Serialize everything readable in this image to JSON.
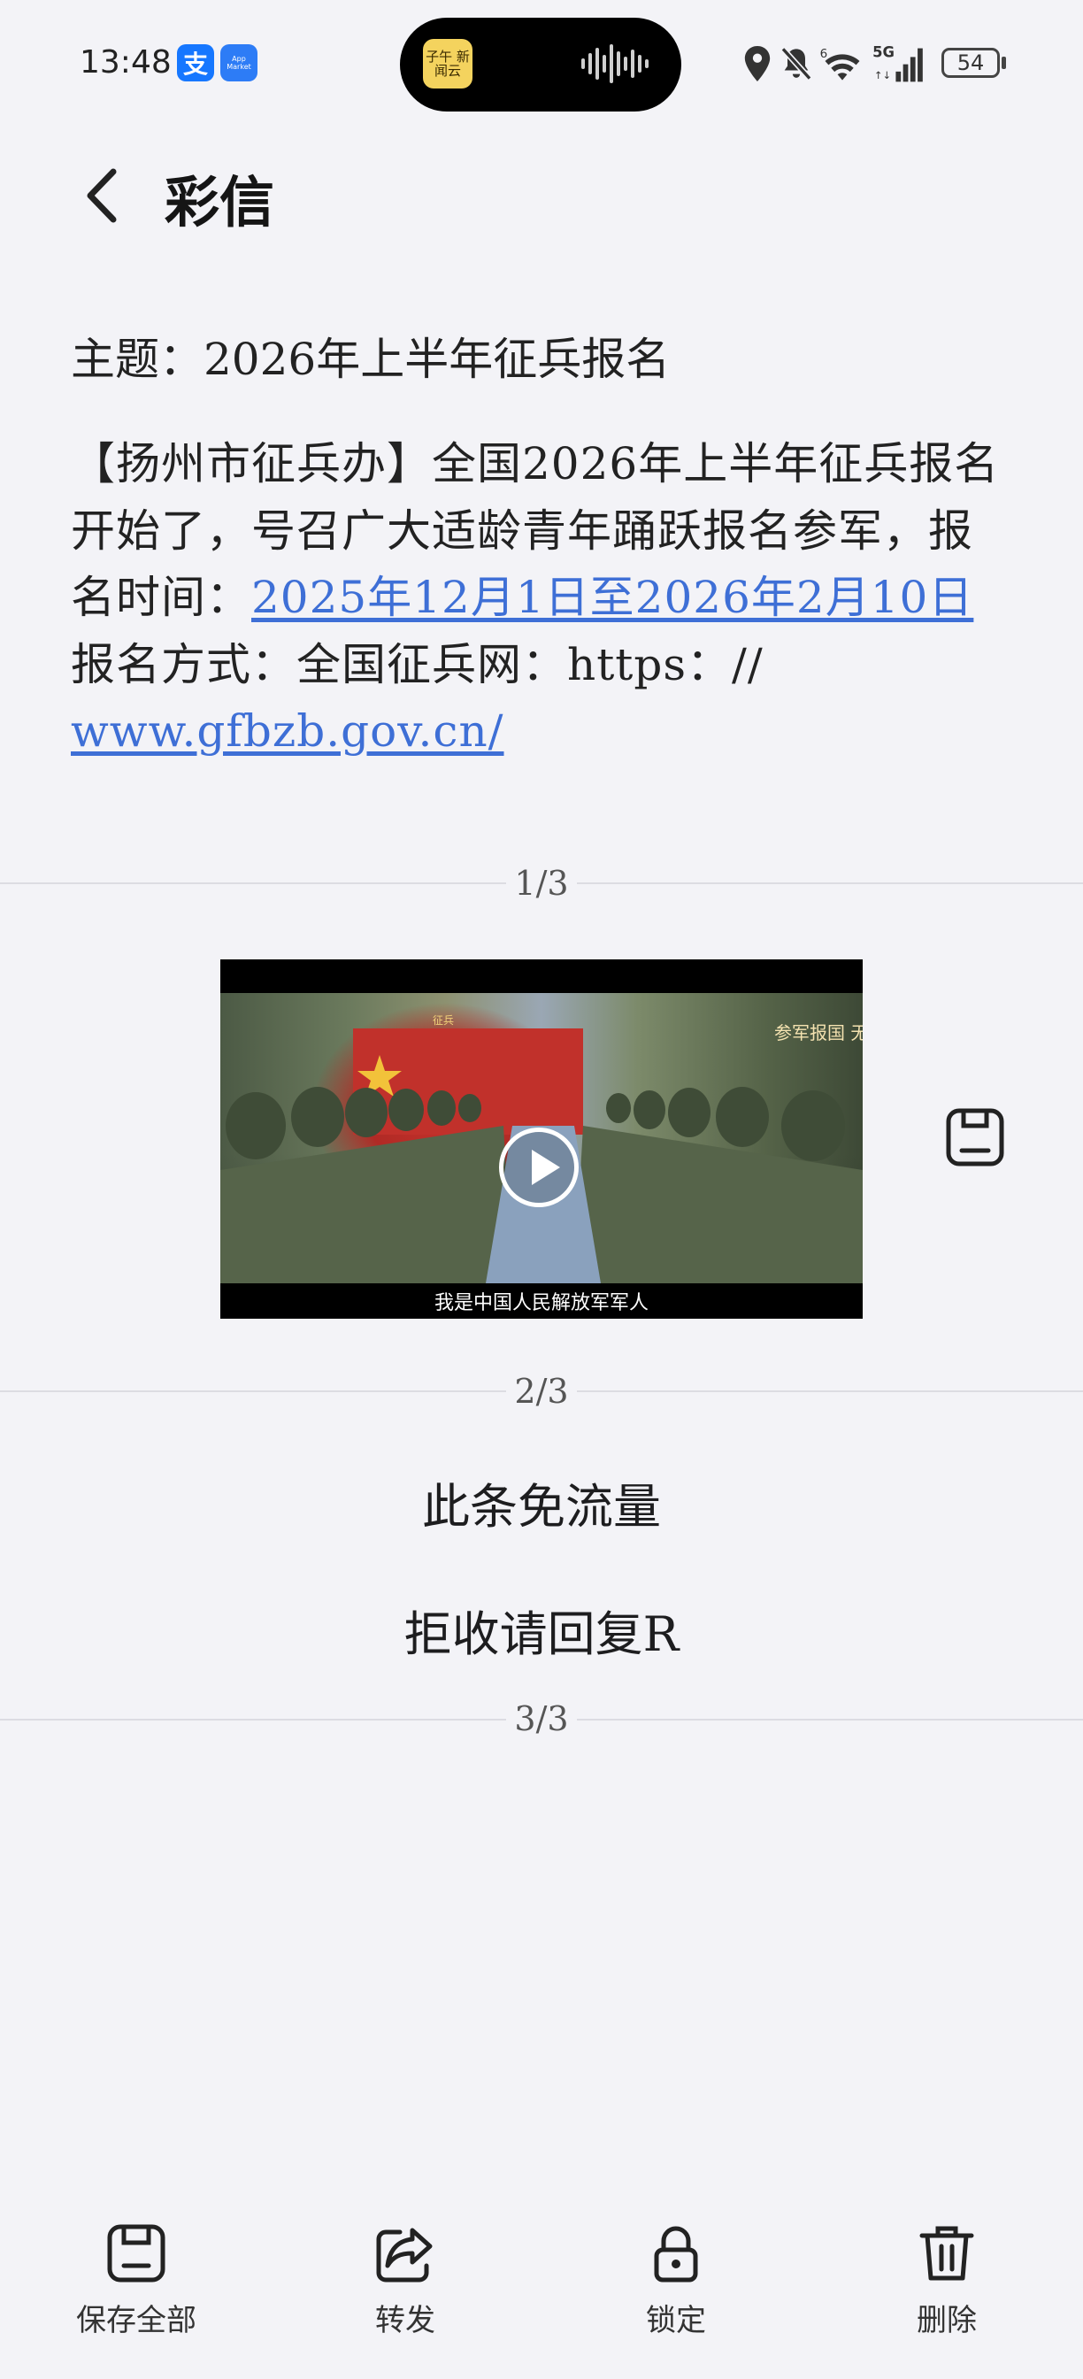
{
  "status_bar": {
    "time": "13:48",
    "alipay_glyph": "支",
    "app_market_label": "App Market",
    "island_app_label": "子午 新闻云",
    "battery_level": "54",
    "icons": [
      "location-icon",
      "mute-icon",
      "wifi-icon",
      "5g-signal-icon",
      "battery-icon"
    ]
  },
  "header": {
    "title": "彩信",
    "back_icon": "chevron-left-icon"
  },
  "message": {
    "subject": "主题：2026年上半年征兵报名",
    "body_prefix": "【扬州市征兵办】全国2026年上半年征兵报名开始了，号召广大适龄青年踊跃报名参军，报名时间：",
    "date_link": "2025年12月1日至2026年2月10日",
    "body_middle": " 报名方式：全国征兵网：https：//",
    "url_link": "www.gfbzb.gov.cn/"
  },
  "parts": {
    "part1_label": "1/3",
    "part2_label": "2/3",
    "part3_label": "3/3",
    "video_caption": "我是中国人民解放军军人",
    "video_logo_text": "参军报国 无上光荣",
    "banner_text": "征兵",
    "part2_line1": "此条免流量",
    "part2_line2": "拒收请回复R"
  },
  "bottom_bar": {
    "items": [
      {
        "label": "保存全部",
        "icon": "save-icon"
      },
      {
        "label": "转发",
        "icon": "share-icon"
      },
      {
        "label": "锁定",
        "icon": "lock-icon"
      },
      {
        "label": "删除",
        "icon": "trash-icon"
      }
    ]
  },
  "colors": {
    "background": "#f3f3f7",
    "link": "#3e6fd6",
    "text": "#1d1d1f"
  }
}
